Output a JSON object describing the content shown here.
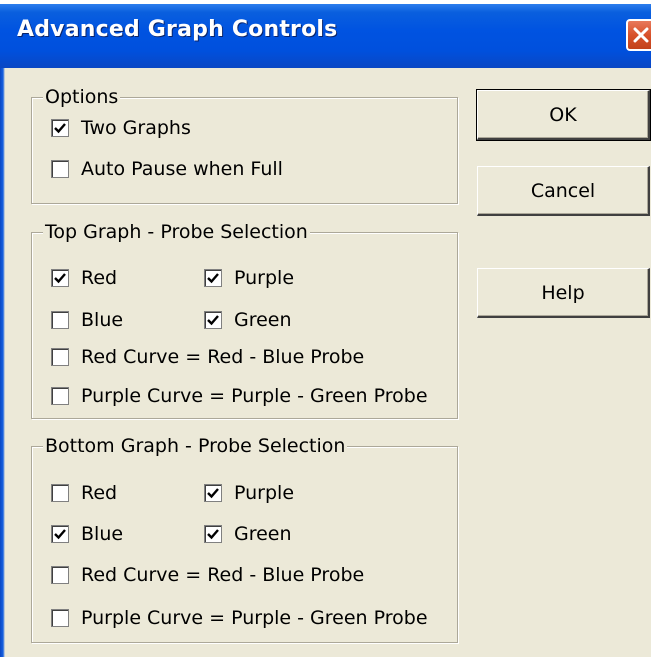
{
  "window": {
    "title": "Advanced Graph Controls"
  },
  "options": {
    "legend": "Options",
    "items": [
      {
        "label": "Two Graphs",
        "checked": true
      },
      {
        "label": "Auto Pause when Full",
        "checked": false
      }
    ]
  },
  "top_graph": {
    "legend": "Top Graph - Probe Selection",
    "items": [
      {
        "label": "Red",
        "checked": true
      },
      {
        "label": "Purple",
        "checked": true
      },
      {
        "label": "Blue",
        "checked": false
      },
      {
        "label": "Green",
        "checked": true
      },
      {
        "label": "Red Curve = Red - Blue Probe",
        "checked": false
      },
      {
        "label": "Purple Curve = Purple - Green Probe",
        "checked": false
      }
    ]
  },
  "bottom_graph": {
    "legend": "Bottom Graph - Probe Selection",
    "items": [
      {
        "label": "Red",
        "checked": false
      },
      {
        "label": "Purple",
        "checked": true
      },
      {
        "label": "Blue",
        "checked": true
      },
      {
        "label": "Green",
        "checked": true
      },
      {
        "label": "Red Curve = Red - Blue Probe",
        "checked": false
      },
      {
        "label": "Purple Curve = Purple - Green Probe",
        "checked": false
      }
    ]
  },
  "buttons": {
    "ok": "OK",
    "cancel": "Cancel",
    "help": "Help"
  },
  "icons": {
    "close": "close-icon",
    "check": "check-icon"
  },
  "colors": {
    "titlebar": "#0053e1",
    "close_button": "#d8512a",
    "dialog_bg": "#ece9d8"
  }
}
